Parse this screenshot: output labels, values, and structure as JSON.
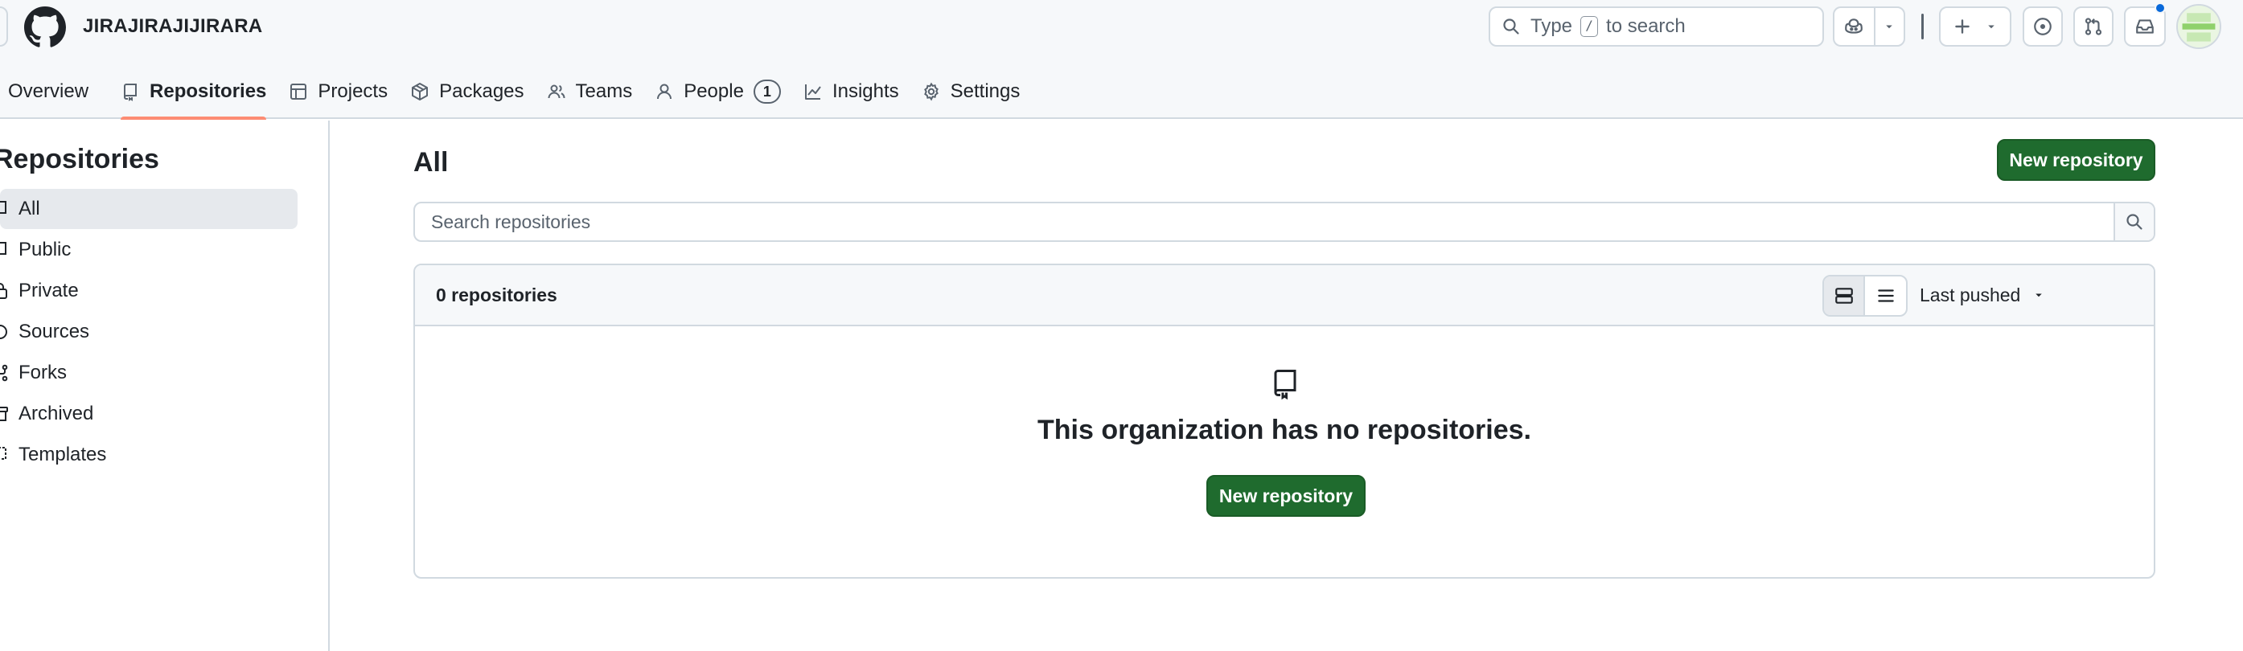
{
  "header": {
    "org_name": "JIRAJIRAJIJIRARA",
    "search": {
      "before_key": "Type",
      "key": "/",
      "after_key": "to search"
    }
  },
  "nav": {
    "tabs": [
      {
        "label": "Overview",
        "icon": "book-icon"
      },
      {
        "label": "Repositories",
        "icon": "repo-icon",
        "active": true
      },
      {
        "label": "Projects",
        "icon": "table-icon"
      },
      {
        "label": "Packages",
        "icon": "package-icon"
      },
      {
        "label": "Teams",
        "icon": "people-icon"
      },
      {
        "label": "People",
        "icon": "person-icon",
        "count": "1"
      },
      {
        "label": "Insights",
        "icon": "graph-icon"
      },
      {
        "label": "Settings",
        "icon": "gear-icon"
      }
    ]
  },
  "sidebar": {
    "title": "Repositories",
    "items": [
      {
        "label": "All",
        "active": true
      },
      {
        "label": "Public"
      },
      {
        "label": "Private"
      },
      {
        "label": "Sources"
      },
      {
        "label": "Forks"
      },
      {
        "label": "Archived"
      },
      {
        "label": "Templates"
      }
    ]
  },
  "main": {
    "title": "All",
    "new_repo_label": "New repository",
    "search_placeholder": "Search repositories",
    "count_label": "0 repositories",
    "sort_label": "Last pushed",
    "empty_message": "This organization has no repositories.",
    "empty_button_label": "New repository"
  },
  "colors": {
    "primary_button": "#1f6b2e",
    "active_tab_underline": "#fd8c73",
    "notification_dot": "#0969da"
  }
}
